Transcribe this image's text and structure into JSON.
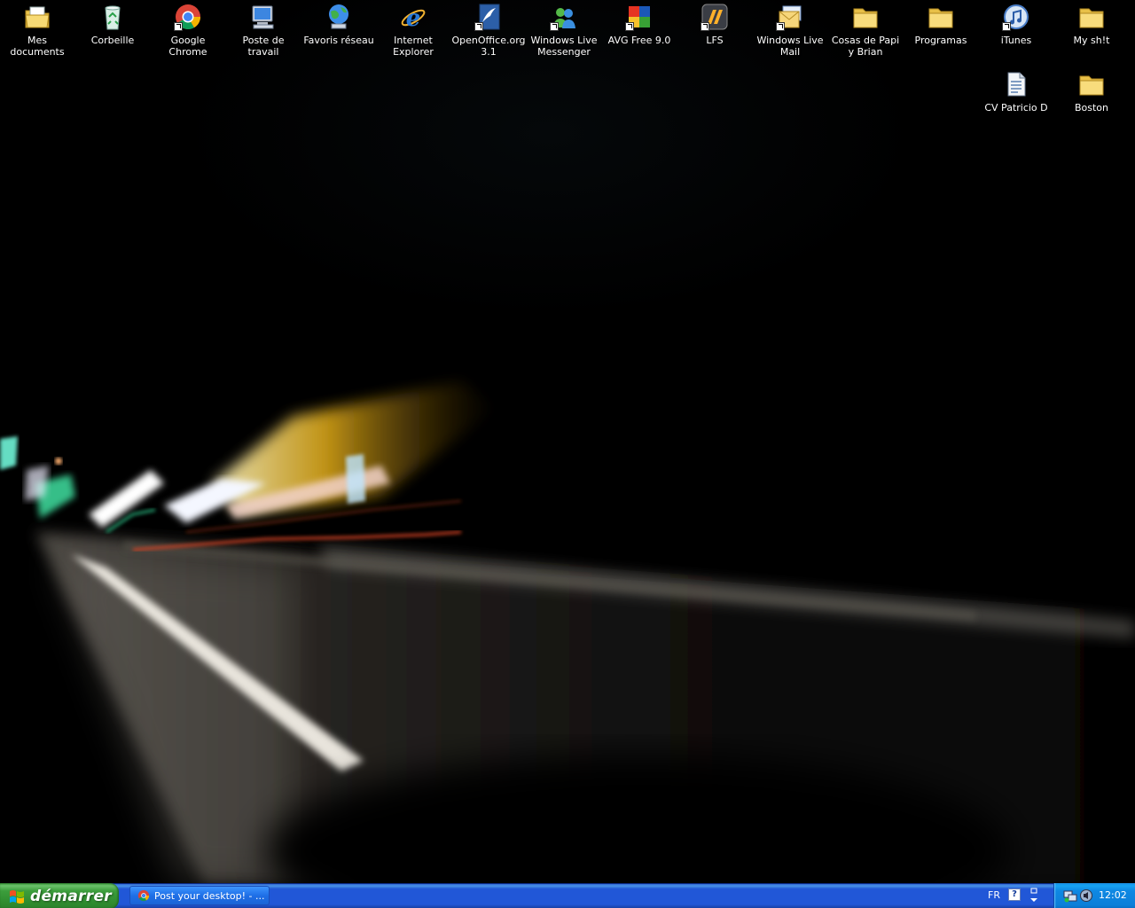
{
  "desktop": {
    "icons": [
      {
        "label": "Mes documents",
        "icon": "my-documents-icon"
      },
      {
        "label": "Corbeille",
        "icon": "recycle-bin-icon"
      },
      {
        "label": "Google Chrome",
        "icon": "google-chrome-icon"
      },
      {
        "label": "Poste de travail",
        "icon": "my-computer-icon"
      },
      {
        "label": "Favoris réseau",
        "icon": "network-places-icon"
      },
      {
        "label": "Internet Explorer",
        "icon": "internet-explorer-icon"
      },
      {
        "label": "OpenOffice.org 3.1",
        "icon": "openoffice-icon"
      },
      {
        "label": "Windows Live Messenger",
        "icon": "windows-live-messenger-icon"
      },
      {
        "label": "AVG Free 9.0",
        "icon": "avg-antivirus-icon"
      },
      {
        "label": "LFS",
        "icon": "lfs-game-icon"
      },
      {
        "label": "Windows Live Mail",
        "icon": "windows-live-mail-icon"
      },
      {
        "label": "Cosas de Papi y Brian",
        "icon": "folder-icon"
      },
      {
        "label": "Programas",
        "icon": "folder-icon"
      },
      {
        "label": "iTunes",
        "icon": "itunes-icon"
      },
      {
        "label": "My  sh!t",
        "icon": "folder-icon"
      },
      {
        "label": "CV Patricio D",
        "icon": "document-icon"
      },
      {
        "label": "Boston",
        "icon": "folder-icon"
      }
    ]
  },
  "taskbar": {
    "start_label": "démarrer",
    "task_button_label": "Post your desktop! - ...",
    "language": "FR",
    "help_symbol": "?",
    "clock": "12:02"
  },
  "colors": {
    "taskbar_blue": "#2157d7",
    "start_green": "#3c9e3c",
    "tray_blue": "#0f88e3"
  }
}
